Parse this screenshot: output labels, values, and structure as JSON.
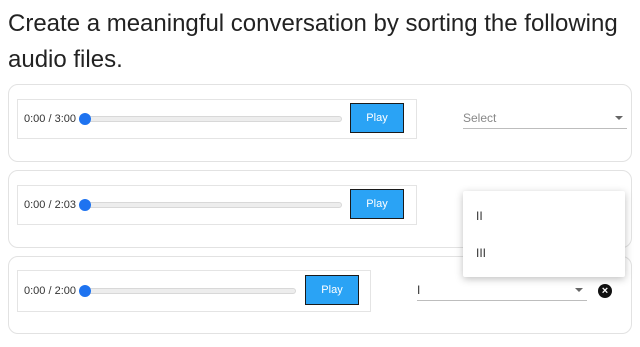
{
  "prompt": "Create a meaningful conversation by sorting the following audio files.",
  "items": [
    {
      "time": "0:00 / 3:00",
      "play_label": "Play",
      "select_value": "Select",
      "progress": 0
    },
    {
      "time": "0:00 / 2:03",
      "play_label": "Play",
      "select_value": "",
      "progress": 0
    },
    {
      "time": "0:00 / 2:00",
      "play_label": "Play",
      "select_value": "I",
      "progress": 0
    }
  ],
  "dropdown_menu": {
    "options": [
      "II",
      "III"
    ]
  },
  "icons": {
    "clear": "close-circle-icon",
    "arrow": "caret-down-icon"
  },
  "colors": {
    "play_button": "#2aa3f5",
    "slider_thumb": "#1e73f0"
  }
}
